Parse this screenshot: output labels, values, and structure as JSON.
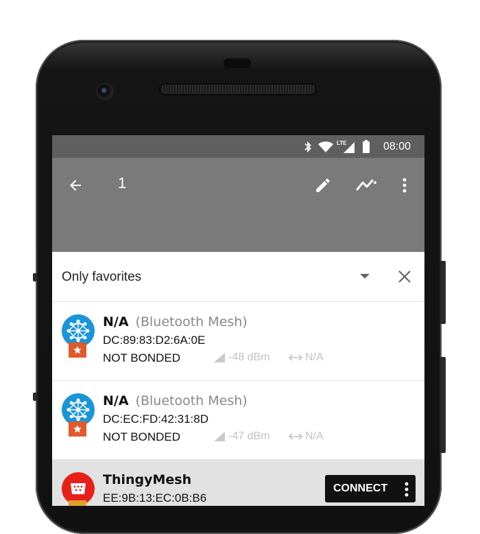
{
  "status_bar": {
    "time": "08:00",
    "network": "LTE"
  },
  "app_bar": {
    "title": "1"
  },
  "filter": {
    "label": "Only favorites"
  },
  "devices": [
    {
      "name": "N/A",
      "type": "(Bluetooth Mesh)",
      "address": "DC:89:83:D2:6A:0E",
      "bond_state": "NOT BONDED",
      "rssi": "-48 dBm",
      "interval": "N/A",
      "favorite": true
    },
    {
      "name": "N/A",
      "type": "(Bluetooth Mesh)",
      "address": "DC:EC:FD:42:31:8D",
      "bond_state": "NOT BONDED",
      "rssi": "-47 dBm",
      "interval": "N/A",
      "favorite": true
    },
    {
      "name": "ThingyMesh",
      "type": "",
      "address": "EE:9B:13:EC:0B:B6",
      "connect_label": "CONNECT"
    }
  ],
  "colors": {
    "status_bar": "#5f5f5f",
    "app_bar": "#7a7a7a",
    "mesh_icon": "#1a95d8",
    "thingy_icon": "#e8201a",
    "favorite_badge": "#e0592b"
  }
}
